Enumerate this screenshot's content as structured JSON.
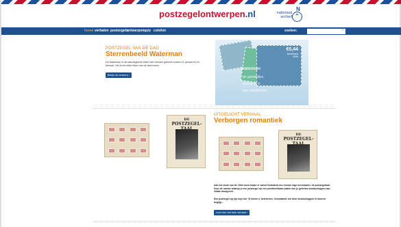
{
  "site": {
    "logo_red": "postzegelontwerpen",
    "logo_suffix": ".nl",
    "partner_top": "nationaal",
    "partner_bottom": "archief",
    "partner_letter": "N"
  },
  "nav": {
    "items": [
      {
        "label": "home",
        "active": true
      },
      {
        "label": "verhalen",
        "active": false
      },
      {
        "label": "postzegels",
        "active": false
      },
      {
        "label": "ontwerpen",
        "active": false
      },
      {
        "label": "quiz",
        "active": false
      },
      {
        "label": "colofon",
        "active": false
      }
    ],
    "search_label": "zoeken:",
    "search_placeholder": "",
    "search_button": "›"
  },
  "stamp_of_day": {
    "kicker": "Postzegel van de dag",
    "title": "Sterrenbeeld Waterman",
    "description": "De Waterman is het astrologische teken van mensen geboren tussen 21 januari en 19 februari. Het is het elfde teken van de dierenriem.",
    "button": "Bekijk de ontwerp ›",
    "stamp_value": "€0,44",
    "stamp_country": "Nederland",
    "stamp_year": "2008",
    "stamp_word1": "waterman",
    "stamp_word2": "de geestelijke",
    "stamp_word3": "stroom zich",
    "stamp_word4": "kan ontwikkelen"
  },
  "featured": {
    "kicker": "Uitgelicht verhaal",
    "title": "Verborgen romantiek",
    "booklet_title_1": "DE",
    "booklet_title_2": "POSTZEGEL-TAAL",
    "paragraph1": "Aan het einde van de 19de eeuw kwam er vanuit Duitsland een nieuwe rage overwaaien: de postzegeltaal. Door de manier waarop je een postzegel op een prentbriefkaart plakte kon je geheime boodschappen aan elkaar doorgeven.",
    "paragraph2": "Een postzegel op zijn kop hier ‘ik bemin u’ betekenen. Voorwaarde om deze boodschappen te kunnen begrijp...",
    "button": "Lees hier het hele verhaal ›"
  },
  "colors": {
    "navy": "#1e4f8f",
    "orange": "#e87e04",
    "red": "#c8102e"
  }
}
